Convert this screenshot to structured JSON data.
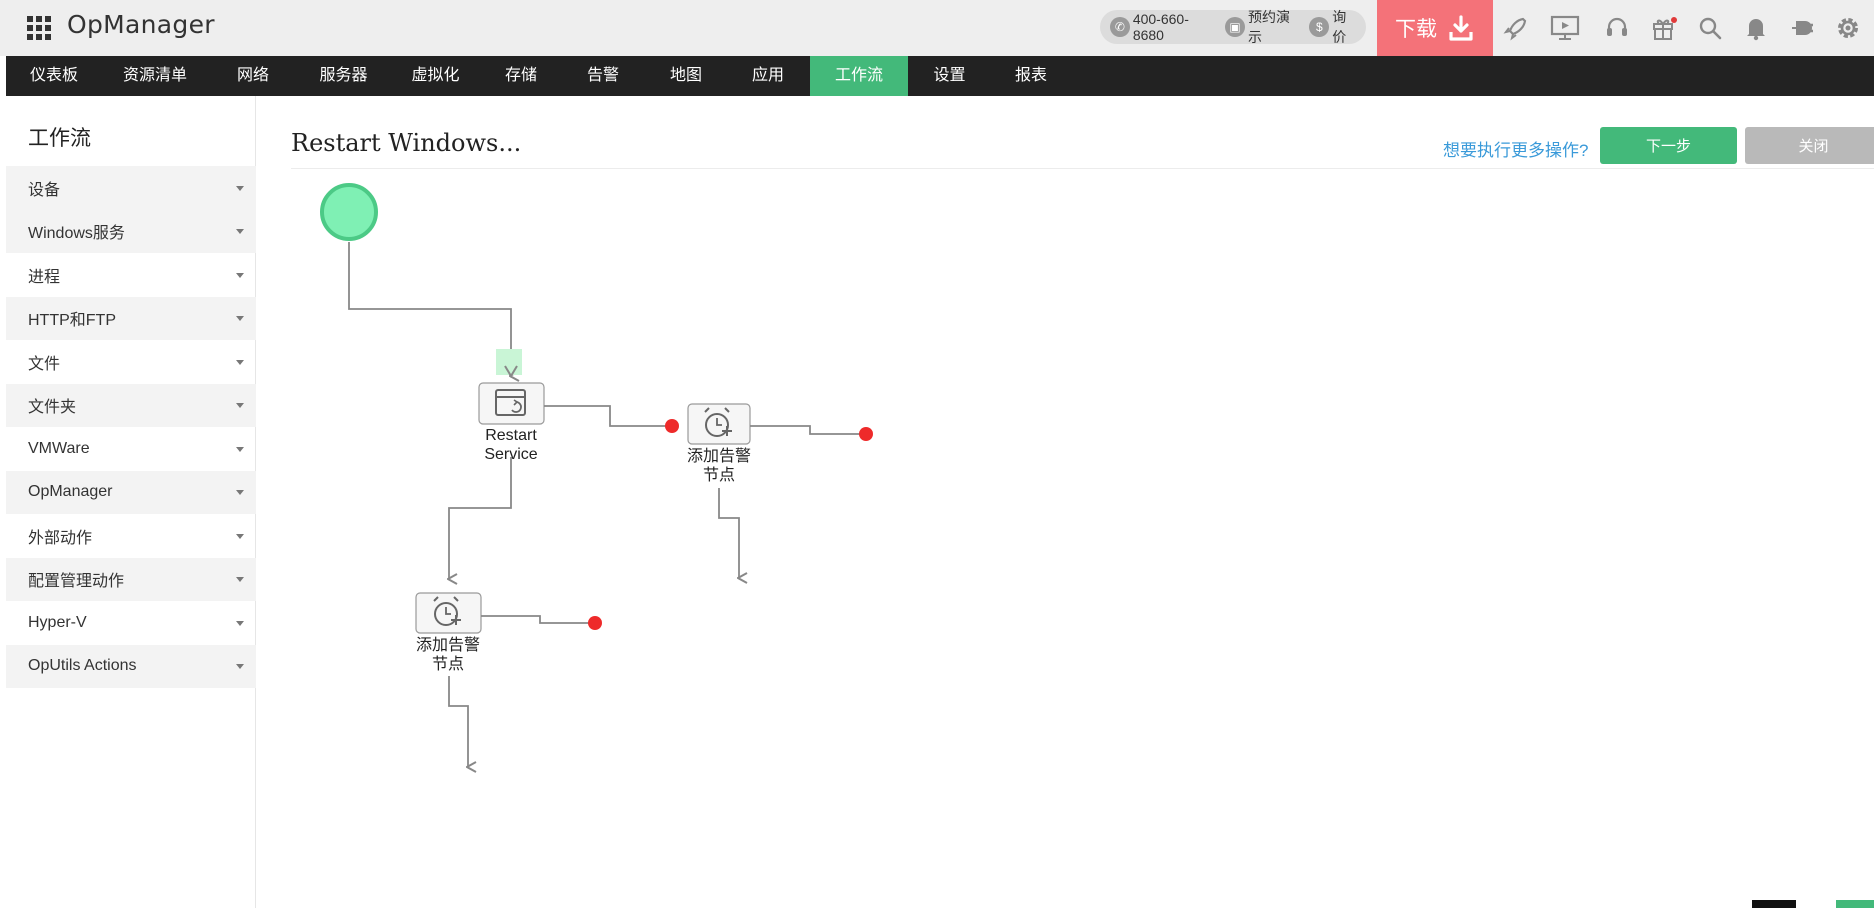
{
  "app": {
    "title": "OpManager"
  },
  "topbar": {
    "phone": "400-660-8680",
    "demo": "预约演示",
    "price": "询价",
    "download_label": "下载",
    "icons": [
      "rocket-icon",
      "presentation-icon",
      "headset-icon",
      "gift-icon",
      "search-icon",
      "bell-icon",
      "plug-icon",
      "gear-icon"
    ]
  },
  "nav": {
    "items": [
      {
        "label": "仪表板"
      },
      {
        "label": "资源清单"
      },
      {
        "label": "网络"
      },
      {
        "label": "服务器"
      },
      {
        "label": "虚拟化"
      },
      {
        "label": "存储"
      },
      {
        "label": "告警"
      },
      {
        "label": "地图"
      },
      {
        "label": "应用"
      },
      {
        "label": "工作流",
        "active": true
      },
      {
        "label": "设置"
      },
      {
        "label": "报表"
      }
    ]
  },
  "sidebar": {
    "title": "工作流",
    "items": [
      {
        "label": "设备"
      },
      {
        "label": "Windows服务"
      },
      {
        "label": "进程"
      },
      {
        "label": "HTTP和FTP"
      },
      {
        "label": "文件"
      },
      {
        "label": "文件夹"
      },
      {
        "label": "VMWare"
      },
      {
        "label": "OpManager"
      },
      {
        "label": "外部动作"
      },
      {
        "label": "配置管理动作"
      },
      {
        "label": "Hyper-V"
      },
      {
        "label": "OpUtils Actions"
      }
    ]
  },
  "main": {
    "title": "Restart Windows...",
    "more_link": "想要执行更多操作?",
    "next_button": "下一步",
    "close_button": "关闭"
  },
  "workflow": {
    "nodes": [
      {
        "label_line1": "Restart",
        "label_line2": "Service",
        "icon": "restart-window-icon"
      },
      {
        "label_line1": "添加告警",
        "label_line2": "节点",
        "icon": "alarm-add-icon"
      },
      {
        "label_line1": "添加告警",
        "label_line2": "节点",
        "icon": "alarm-add-icon"
      }
    ],
    "colors": {
      "start": "#7ff0b4",
      "start_border": "#4cca86",
      "connector": "#888888",
      "fail_dot": "#ee2a2a",
      "drop_target": "#c9f5d6"
    }
  }
}
